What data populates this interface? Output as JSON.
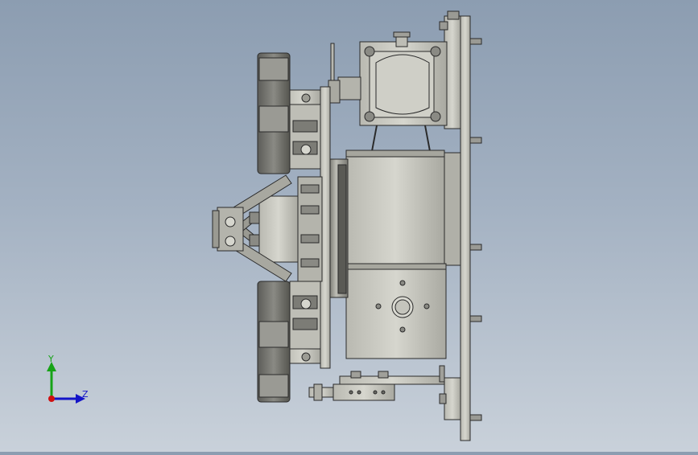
{
  "view": {
    "background_top": "#8c9db1",
    "background_bottom": "#c9d1da",
    "part_color": "#c8c8c0",
    "part_dark": "#7e7e78",
    "edge_color": "#2a2a2a"
  },
  "triad": {
    "y_label": "Y",
    "z_label": "Z",
    "y_color": "#17a317",
    "z_color": "#1414c8",
    "origin_color": "#d01010"
  }
}
